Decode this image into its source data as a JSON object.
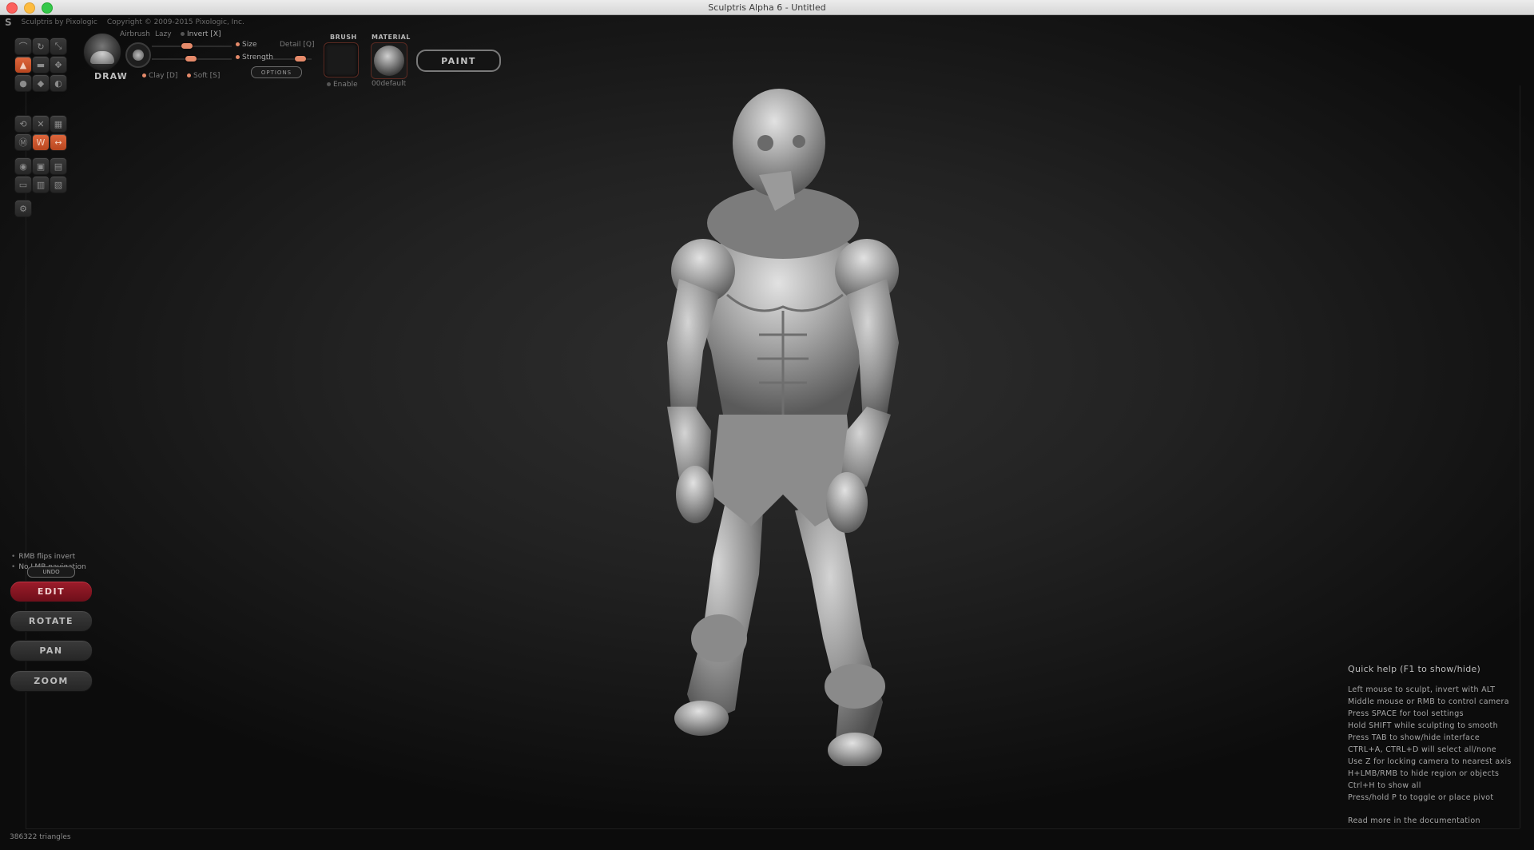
{
  "window": {
    "title": "Sculptris Alpha 6 - Untitled"
  },
  "appbar": {
    "logo": "S",
    "app_name": "Sculptris by Pixologic",
    "copyright": "Copyright © 2009-2015 Pixologic, Inc."
  },
  "brush": {
    "mode_label": "DRAW",
    "airbrush": "Airbrush",
    "lazy": "Lazy",
    "invert": "Invert [X]",
    "size": "Size",
    "detail": "Detail [Q]",
    "strength": "Strength",
    "options": "OPTIONS",
    "clay": "Clay [D]",
    "soft": "Soft [S]",
    "brush_title": "BRUSH",
    "material_title": "MATERIAL",
    "enable": "Enable",
    "material_name": "00default",
    "paint": "PAINT"
  },
  "bottom_left": {
    "hint1": "RMB flips invert",
    "hint2": "No LMB navigation",
    "undo": "UNDO",
    "edit": "EDIT",
    "rotate": "ROTATE",
    "pan": "PAN",
    "zoom": "ZOOM",
    "triangles": "386322 triangles"
  },
  "help": {
    "title": "Quick help (F1 to show/hide)",
    "lines": [
      "Left mouse to sculpt, invert with ALT",
      "Middle mouse or RMB to control camera",
      "Press SPACE for tool settings",
      "Hold SHIFT while sculpting to smooth",
      "Press TAB to show/hide interface",
      "CTRL+A, CTRL+D will select all/none",
      "Use Z for locking camera to nearest axis",
      "H+LMB/RMB to hide region or objects",
      "Ctrl+H to show all",
      "Press/hold P to toggle or place pivot"
    ],
    "more": "Read more in the documentation"
  },
  "colors": {
    "accent": "#e0683e",
    "edit_active": "#9c1c2a",
    "slider": "#e58a6a"
  }
}
